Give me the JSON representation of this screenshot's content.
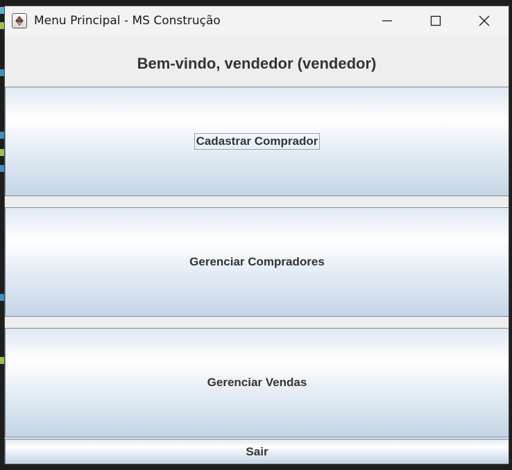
{
  "window": {
    "title": "Menu Principal - MS Construção",
    "controls": {
      "minimize_icon": "minimize-icon",
      "maximize_icon": "maximize-icon",
      "close_icon": "close-icon"
    }
  },
  "main": {
    "welcome": "Bem-vindo, vendedor (vendedor)",
    "buttons": {
      "register_buyer": "Cadastrar Comprador",
      "manage_buyers": "Gerenciar Compradores",
      "manage_sales": "Gerenciar Vendas",
      "exit": "Sair"
    }
  },
  "colors": {
    "text": "#333333",
    "button_top": "#dfe8f2",
    "button_bottom": "#c4d5e6",
    "button_border": "#7a8a99",
    "focus_border": "#8fa4ba"
  }
}
